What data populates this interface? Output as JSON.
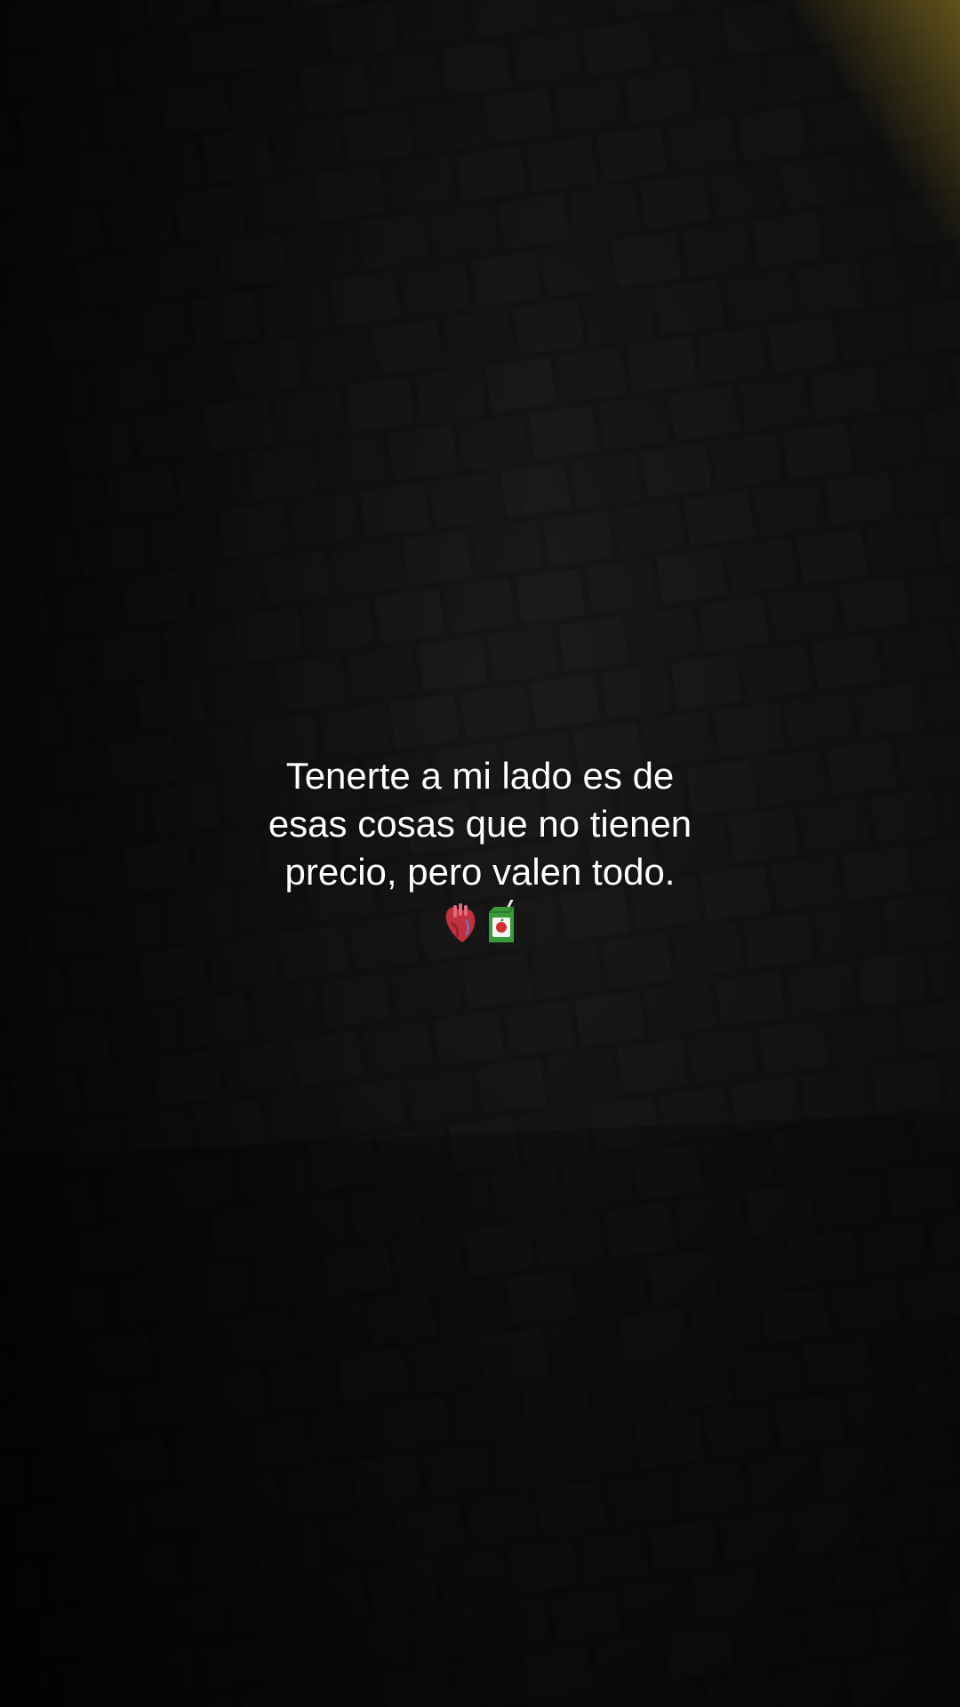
{
  "caption": {
    "line1": "Tenerte a mi lado es de",
    "line2": "esas cosas que no tienen",
    "line3": "precio, pero valen todo."
  },
  "emojis": [
    {
      "icon": "anatomical-heart-icon",
      "color": "#c0313f"
    },
    {
      "icon": "juice-box-icon",
      "color": "#3a9a3a"
    }
  ],
  "colors": {
    "background": "#1d1d1d",
    "text": "#ffffff",
    "accent_corner": "#6b5a1c"
  }
}
